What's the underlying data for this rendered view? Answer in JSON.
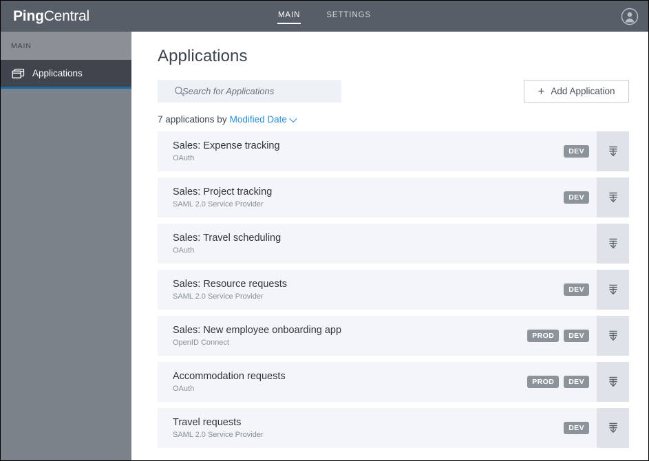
{
  "topbar": {
    "brand_strong": "Ping",
    "brand_light": "Central",
    "nav": [
      {
        "label": "MAIN",
        "active": true
      },
      {
        "label": "SETTINGS",
        "active": false
      }
    ],
    "avatar_icon": "user-avatar-icon"
  },
  "sidebar": {
    "section_label": "MAIN",
    "items": [
      {
        "label": "Applications",
        "icon": "applications-windows-icon",
        "active": true
      }
    ],
    "accent_color": "#1b6ba8",
    "background_color": "#7c828a",
    "active_background_color": "#3f444d"
  },
  "main": {
    "page_title": "Applications",
    "search": {
      "placeholder": "Search for Applications",
      "value": "",
      "icon": "search-icon"
    },
    "add_button": {
      "label": "Add Application",
      "icon": "plus-icon"
    },
    "sort": {
      "count_text": "7 applications by",
      "sort_field": "Modified Date",
      "caret_icon": "chevron-down-icon",
      "link_color": "#2a8fd4"
    },
    "row_action_icon": "expand-download-icon",
    "applications": [
      {
        "name": "Sales: Expense tracking",
        "protocol": "OAuth",
        "badges": [
          "DEV"
        ]
      },
      {
        "name": "Sales: Project tracking",
        "protocol": "SAML 2.0 Service Provider",
        "badges": [
          "DEV"
        ]
      },
      {
        "name": "Sales: Travel scheduling",
        "protocol": "OAuth",
        "badges": []
      },
      {
        "name": "Sales: Resource requests",
        "protocol": "SAML 2.0 Service Provider",
        "badges": [
          "DEV"
        ]
      },
      {
        "name": "Sales: New employee onboarding app",
        "protocol": "OpenID Connect",
        "badges": [
          "PROD",
          "DEV"
        ]
      },
      {
        "name": "Accommodation requests",
        "protocol": "OAuth",
        "badges": [
          "PROD",
          "DEV"
        ]
      },
      {
        "name": "Travel requests",
        "protocol": "SAML 2.0 Service Provider",
        "badges": [
          "DEV"
        ]
      }
    ]
  }
}
